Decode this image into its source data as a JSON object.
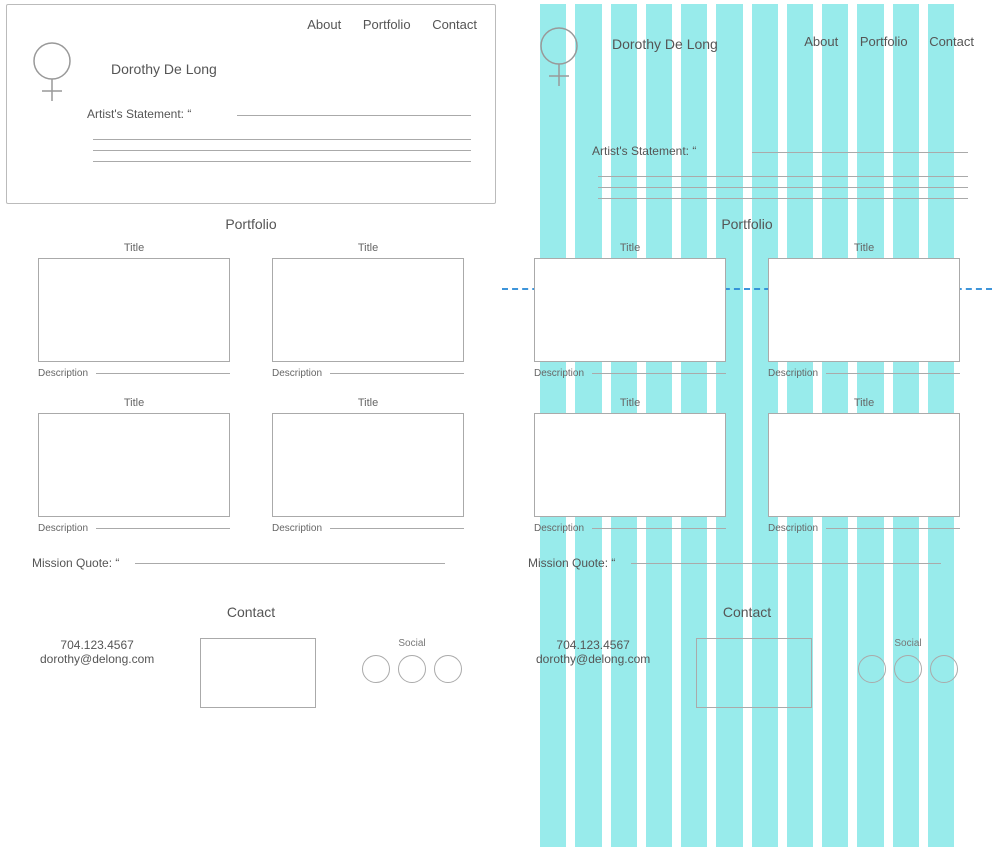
{
  "nav": {
    "about": "About",
    "portfolio": "Portfolio",
    "contact": "Contact"
  },
  "hero": {
    "name": "Dorothy De Long",
    "statement_label": "Artist's Statement: “"
  },
  "sections": {
    "portfolio_title": "Portfolio",
    "contact_title": "Contact"
  },
  "card": {
    "title": "Title",
    "description": "Description"
  },
  "mission": {
    "label": "Mission Quote: “"
  },
  "contact": {
    "phone": "704.123.4567",
    "email": "dorothy@delong.com",
    "social_label": "Social"
  }
}
